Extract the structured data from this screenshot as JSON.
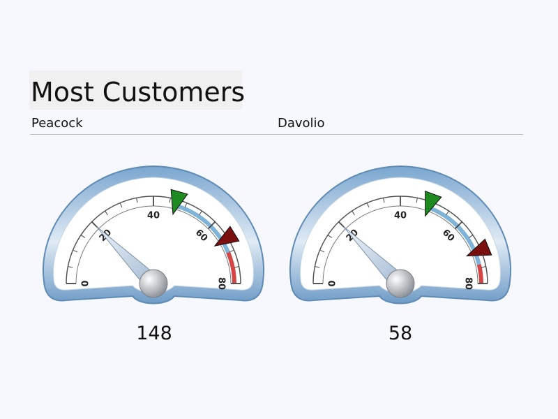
{
  "header": {
    "title": "Most Customers"
  },
  "gauges": [
    {
      "name": "Peacock",
      "value": 148,
      "value_label": "148",
      "pointer_value": 20,
      "range_min": 0,
      "range_max": 80,
      "ticks": [
        "0",
        "20",
        "40",
        "60",
        "80"
      ],
      "green_marker_value": 47,
      "red_marker_value": 66
    },
    {
      "name": "Davolio",
      "value": 58,
      "value_label": "58",
      "pointer_value": 20,
      "range_min": 0,
      "range_max": 80,
      "ticks": [
        "0",
        "20",
        "40",
        "60",
        "80"
      ],
      "green_marker_value": 49,
      "red_marker_value": 70
    }
  ],
  "colors": {
    "frame": "#6f9cc7",
    "frame_light": "#d9e6f2",
    "range_blue": "#7fb3d8",
    "range_red": "#d54545",
    "green_marker": "#1f8a1f",
    "red_marker": "#7a0f0f"
  }
}
